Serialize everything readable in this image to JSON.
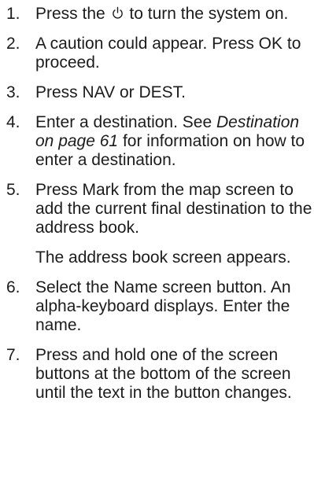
{
  "steps": [
    {
      "number": "1.",
      "before_icon": "Press the",
      "icon": "power-icon",
      "after_icon": " to turn the system on."
    },
    {
      "number": "2.",
      "text": "A caution could appear. Press OK to proceed."
    },
    {
      "number": "3.",
      "text": "Press NAV or DEST."
    },
    {
      "number": "4.",
      "text_before": "Enter a destination. See ",
      "link": "Destination on page 61",
      "text_after": " for information on how to enter a destination."
    },
    {
      "number": "5.",
      "text": "Press Mark from the map screen to add the current final destination to the address book.",
      "note": "The address book screen appears."
    },
    {
      "number": "6.",
      "text": "Select the Name screen button. An alpha-keyboard displays. Enter the name."
    },
    {
      "number": "7.",
      "text": "Press and hold one of the screen buttons at the bottom of the screen until the text in the button changes."
    }
  ]
}
